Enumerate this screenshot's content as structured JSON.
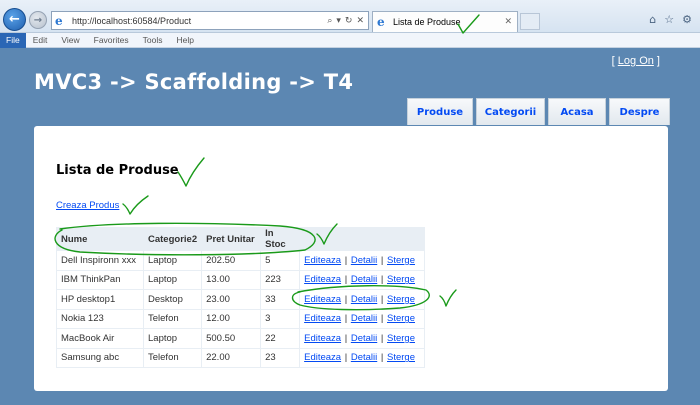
{
  "browser": {
    "url": "http://localhost:60584/Product",
    "tab_title": "Lista de Produse",
    "back_glyph": "←",
    "forward_glyph": "→",
    "address_tools": [
      "⌕",
      "▾",
      "↻",
      "✕"
    ],
    "menu": [
      "File",
      "Edit",
      "View",
      "Favorites",
      "Tools",
      "Help"
    ],
    "toolbar_icons": [
      "⌂",
      "☆",
      "⚙"
    ]
  },
  "header": {
    "logon_open": "[ ",
    "logon_label": "Log On",
    "logon_close": " ]",
    "title": "MVC3 -> Scaffolding -> T4",
    "menu": [
      "Produse",
      "Categorii",
      "Acasa",
      "Despre"
    ]
  },
  "main": {
    "title": "Lista de Produse",
    "create_link": "Creaza Produs",
    "columns": [
      "Nume",
      "Categorie2",
      "Pret Unitar",
      "In Stoc",
      ""
    ],
    "action_labels": {
      "edit": "Editeaza",
      "details": "Detalii",
      "delete": "Sterge",
      "separator": "|"
    },
    "rows": [
      {
        "name": "Dell Inspironn xxx",
        "category": "Laptop",
        "price": "202.50",
        "stock": "5"
      },
      {
        "name": "IBM ThinkPan",
        "category": "Laptop",
        "price": "13.00",
        "stock": "223"
      },
      {
        "name": "HP desktop1",
        "category": "Desktop",
        "price": "23.00",
        "stock": "33"
      },
      {
        "name": "Nokia 123",
        "category": "Telefon",
        "price": "12.00",
        "stock": "3"
      },
      {
        "name": "MacBook Air",
        "category": "Laptop",
        "price": "500.50",
        "stock": "22"
      },
      {
        "name": "Samsung abc",
        "category": "Telefon",
        "price": "22.00",
        "stock": "23"
      }
    ]
  },
  "colors": {
    "page_bg": "#5c87b2",
    "link": "#034af3",
    "annotation": "#1a9a1a"
  }
}
